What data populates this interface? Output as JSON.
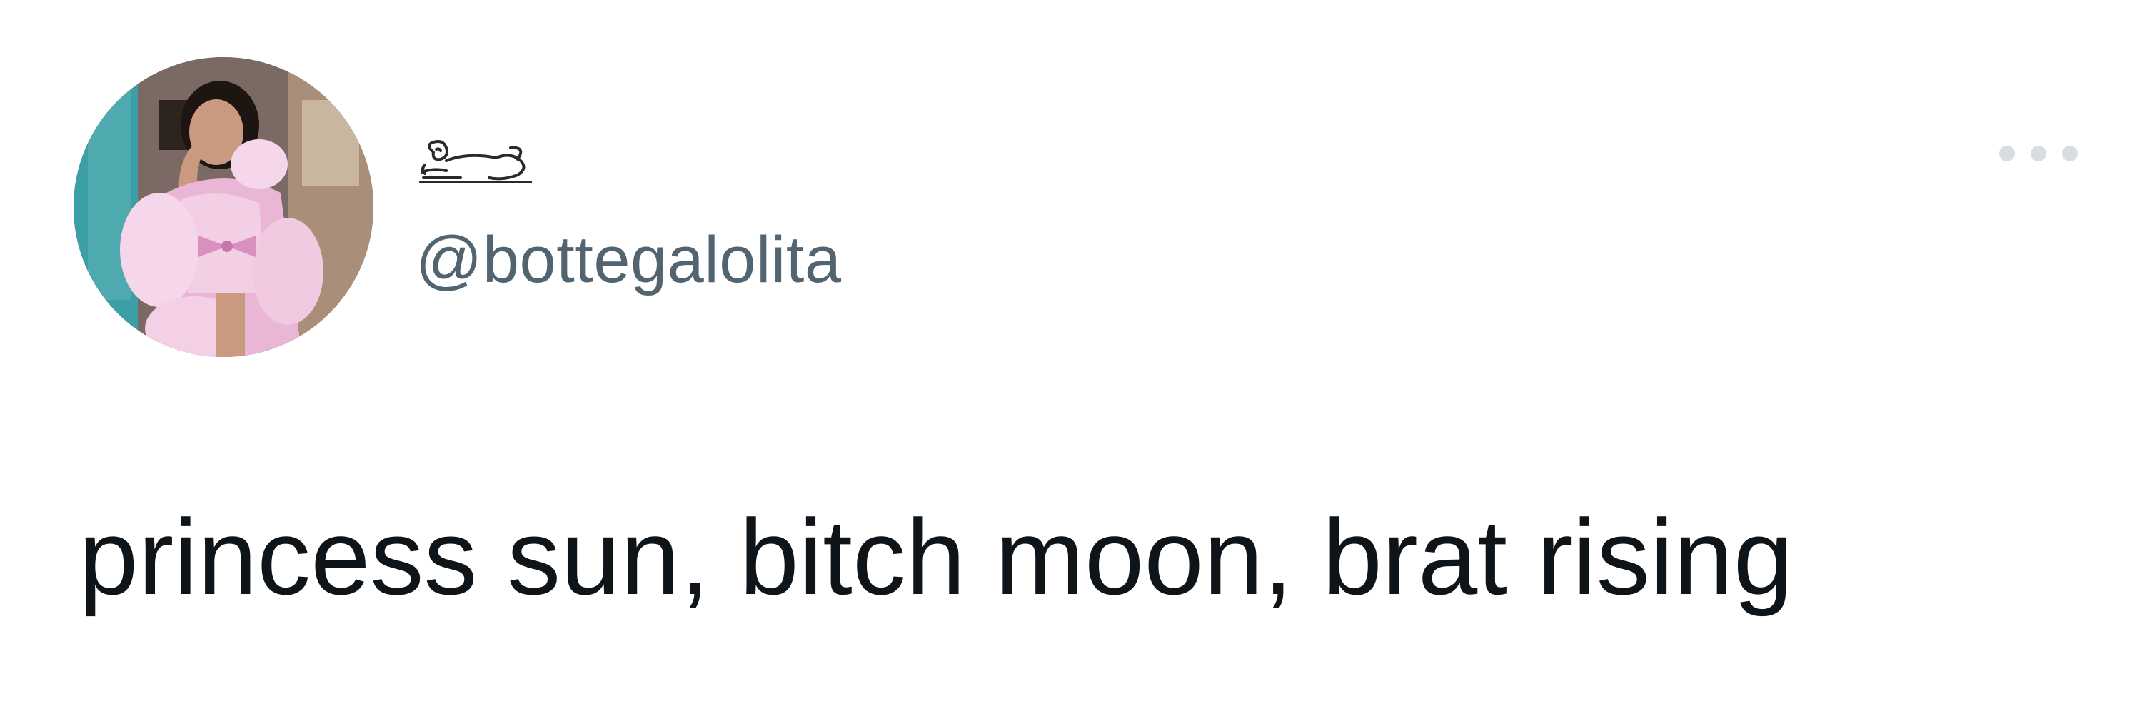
{
  "tweet": {
    "author": {
      "display_name_icon": "reclining-lion-sketch-icon",
      "handle": "@bottegalolita",
      "avatar_icon": "profile-photo-avatar"
    },
    "more_icon": "more-options-icon",
    "text": "princess sun, bitch moon, brat rising"
  },
  "colors": {
    "background": "#ffffff",
    "handle": "#536471",
    "text": "#0f1419",
    "more_dots": "#d9dde1",
    "avatar_accent_pink": "#e9b6d6",
    "avatar_accent_teal": "#3d9fa6"
  }
}
